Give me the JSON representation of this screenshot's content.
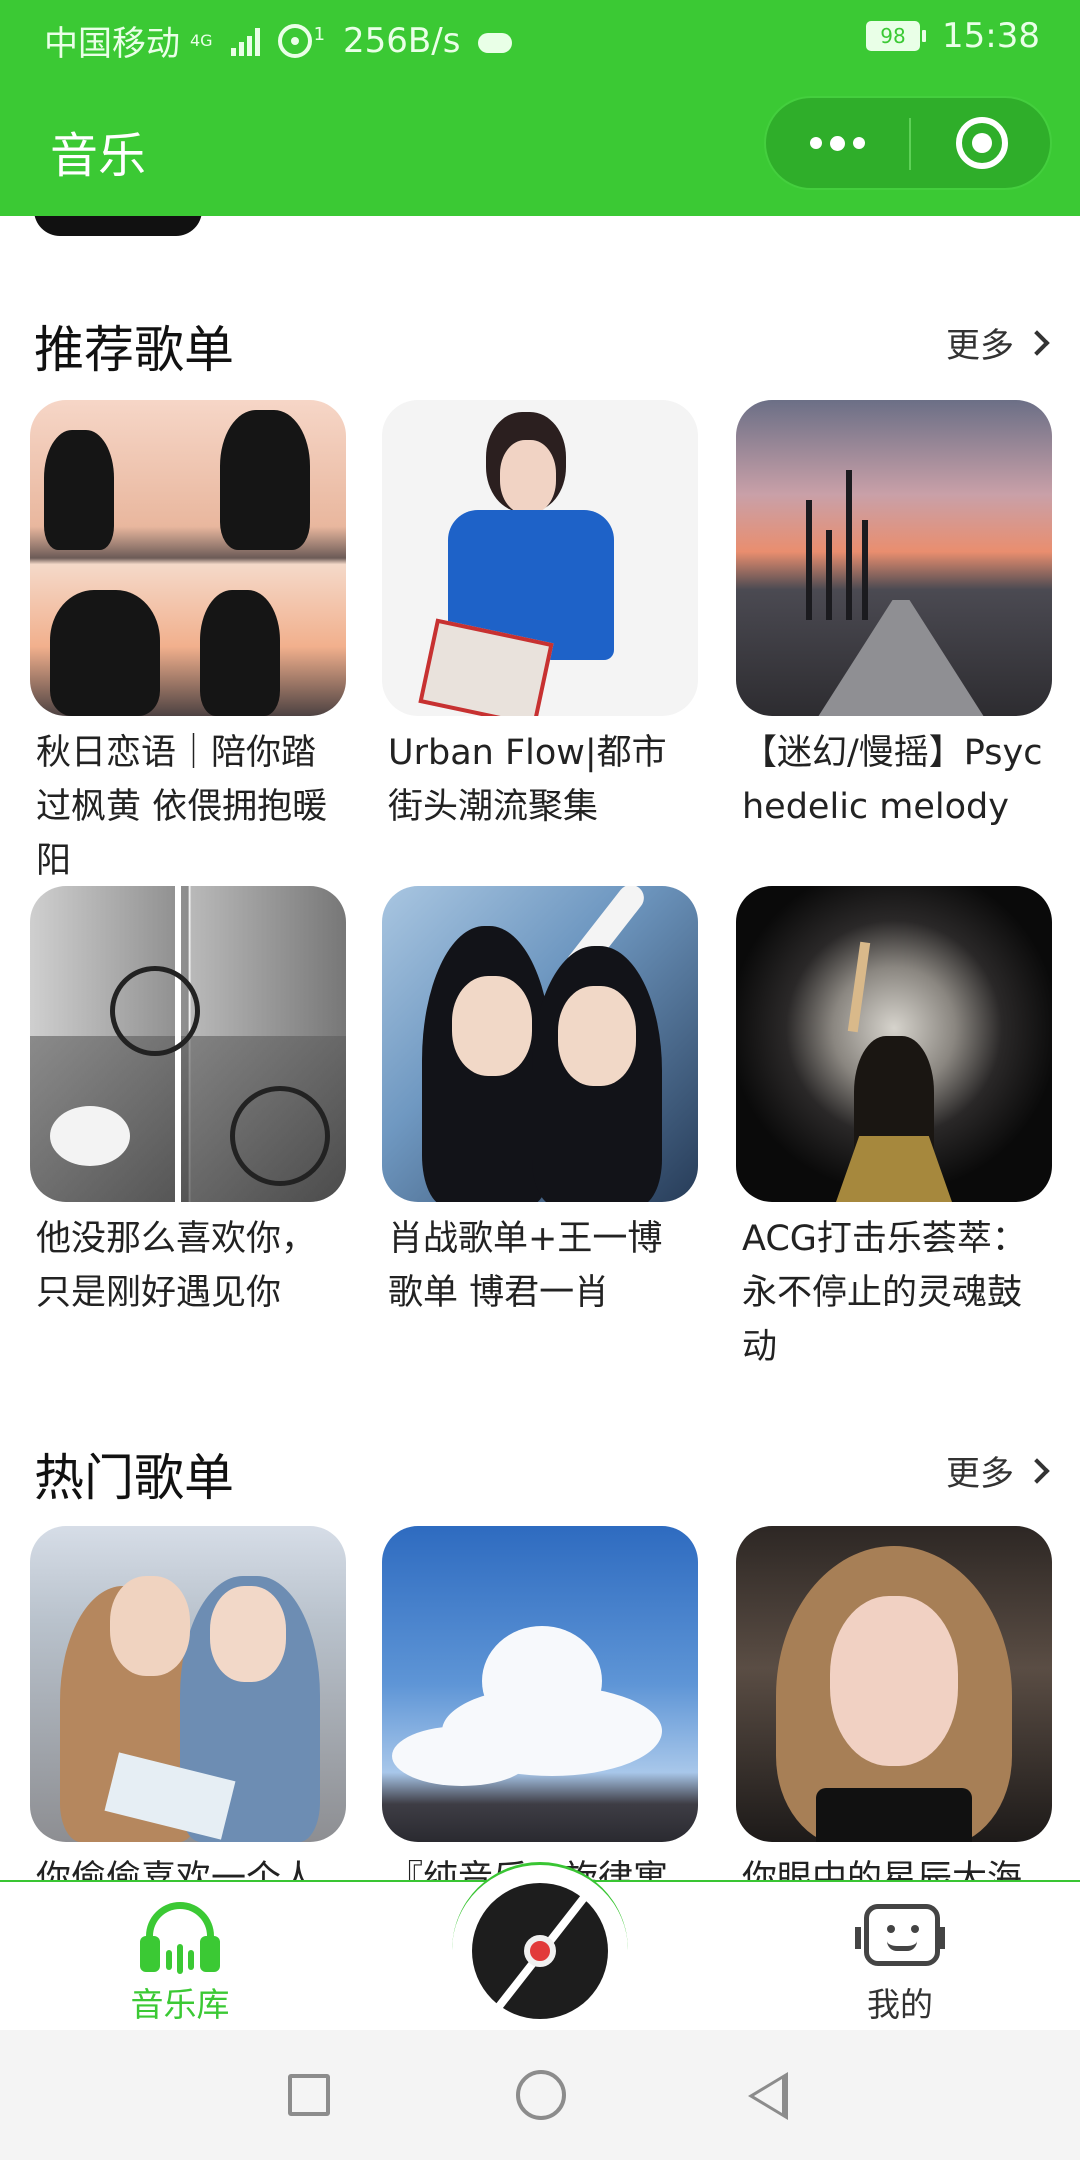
{
  "status_bar": {
    "carrier": "中国移动",
    "network": "4G",
    "hotspot_count": "1",
    "speed": "256B/s",
    "battery": "98",
    "time": "15:38"
  },
  "header": {
    "title": "音乐"
  },
  "sections": [
    {
      "title": "推荐歌单",
      "more_label": "更多",
      "playlists": [
        {
          "title": "秋日恋语｜陪你踏过枫黄 依偎拥抱暖阳"
        },
        {
          "title": "Urban Flow|都市街头潮流聚集"
        },
        {
          "title": "【迷幻/慢摇】Psychedelic melody"
        },
        {
          "title": "他没那么喜欢你，只是刚好遇见你"
        },
        {
          "title": "肖战歌单+王一博歌单 博君一肖"
        },
        {
          "title": "ACG打击乐荟萃：永不停止的灵魂鼓动"
        }
      ]
    },
    {
      "title": "热门歌单",
      "more_label": "更多",
      "playlists": [
        {
          "title": "你偷偷喜欢一个人"
        },
        {
          "title": "『纯音乐』旋律寓"
        },
        {
          "title": "你眼中的星辰大海"
        }
      ]
    }
  ],
  "tab_bar": {
    "library_label": "音乐库",
    "mine_label": "我的",
    "accent_color": "#3bc934"
  },
  "icons": {
    "more": "more-dots-icon",
    "close": "mini-program-close-icon",
    "library": "headphones-icon",
    "player": "vinyl-disc-icon",
    "mine": "robot-face-icon"
  }
}
